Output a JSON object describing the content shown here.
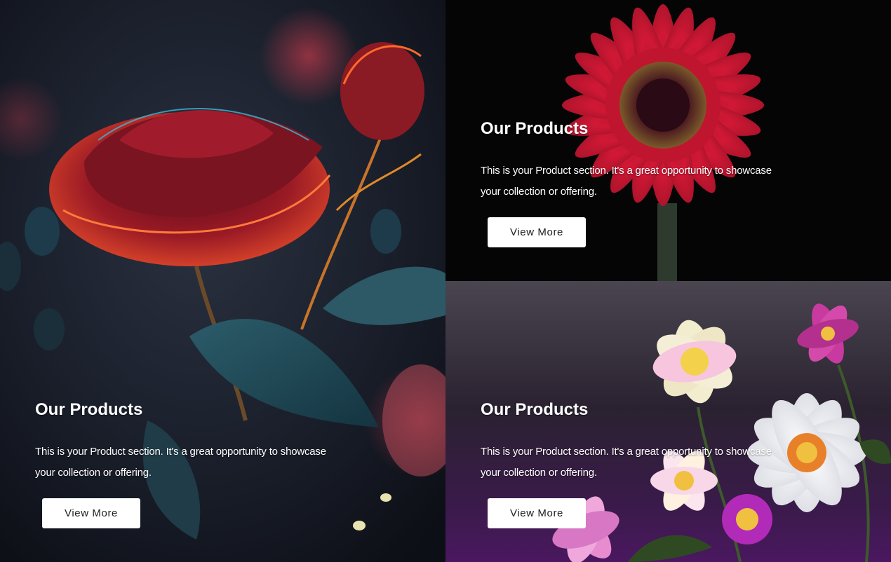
{
  "tiles": [
    {
      "title": "Our Products",
      "description_line1": "This is your Product section. It's a great opportunity to showcase",
      "description_line2": "your collection or offering.",
      "button_label": "View More",
      "image": "glowing-red-rose",
      "accent": "#c8312f"
    },
    {
      "title": "Our Products",
      "description_line1": "This is your Product section. It's a great opportunity to showcase",
      "description_line2": "your collection or offering.",
      "button_label": "View More",
      "image": "red-gerbera-daisy",
      "accent": "#d01835"
    },
    {
      "title": "Our Products",
      "description_line1": "This is your Product section. It's a great opportunity to showcase",
      "description_line2": "your collection or offering.",
      "button_label": "View More",
      "image": "pastel-flower-bouquet",
      "accent": "#4a1e6a"
    }
  ]
}
